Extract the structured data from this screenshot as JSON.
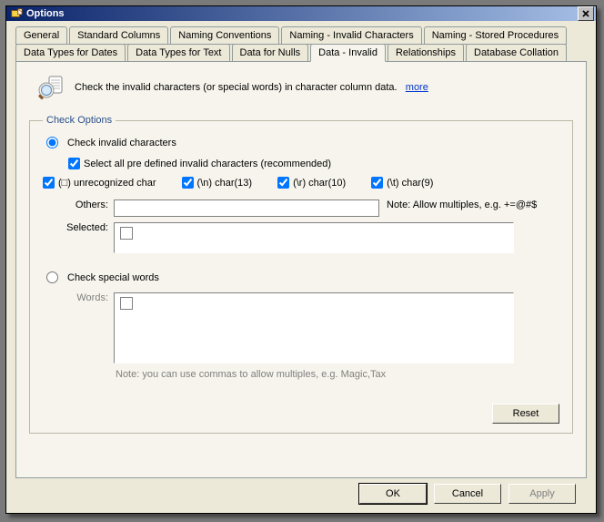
{
  "title": "Options",
  "tabs_row1": [
    {
      "label": "General"
    },
    {
      "label": "Standard Columns"
    },
    {
      "label": "Naming Conventions"
    },
    {
      "label": "Naming - Invalid Characters"
    },
    {
      "label": "Naming - Stored Procedures"
    }
  ],
  "tabs_row2": [
    {
      "label": "Data Types for Dates"
    },
    {
      "label": "Data Types for Text"
    },
    {
      "label": "Data for Nulls"
    },
    {
      "label": "Data - Invalid",
      "active": true
    },
    {
      "label": "Relationships"
    },
    {
      "label": "Database Collation"
    }
  ],
  "description": "Check the invalid characters (or special words) in character column data.",
  "description_more": "more",
  "group_title": "Check Options",
  "radio_invalid": "Check invalid characters",
  "radio_words": "Check special words",
  "predef_label": "Select all pre defined invalid characters (recommended)",
  "invalid": {
    "unrec": "(□) unrecognized char",
    "r13": "(\\n) char(13)",
    "r10": "(\\r) char(10)",
    "r9": "(\\t) char(9)"
  },
  "others_label": "Others:",
  "others_value": "",
  "others_note": "Note: Allow multiples, e.g. +=@#$",
  "selected_label": "Selected:",
  "words_label": "Words:",
  "words_note": "Note: you can use commas to allow multiples, e.g.  Magic,Tax",
  "reset_label": "Reset",
  "buttons": {
    "ok": "OK",
    "cancel": "Cancel",
    "apply": "Apply"
  }
}
